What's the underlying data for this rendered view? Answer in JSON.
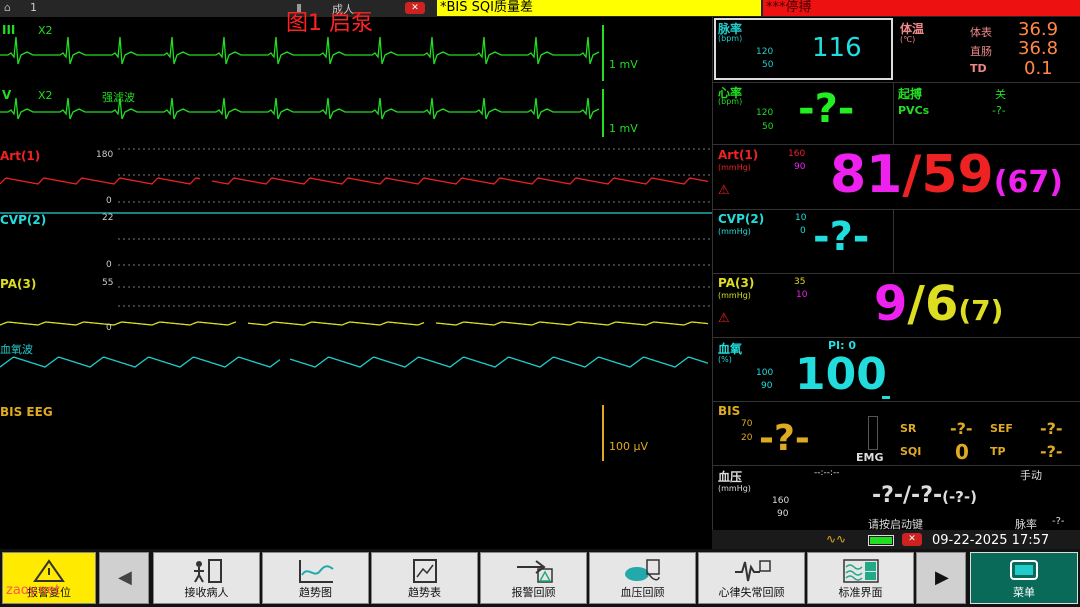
{
  "topbar": {
    "bed_no": "1",
    "patient_type": "成人",
    "overlay_title": "图1 启泵"
  },
  "alarms": {
    "yellow": "*BIS SQI质量差",
    "red": "***停搏"
  },
  "waves": {
    "ecg1": {
      "label": "III",
      "gain": "X2",
      "scale": "1 mV"
    },
    "ecg2": {
      "label": "V",
      "gain": "X2",
      "filter": "强滤波",
      "scale": "1 mV"
    },
    "art": {
      "label": "Art(1)",
      "top": "180",
      "bottom": "0"
    },
    "cvp": {
      "label": "CVP(2)",
      "top": "22",
      "bottom": "0"
    },
    "pa": {
      "label": "PA(3)",
      "top": "55",
      "bottom": "0"
    },
    "spo2": {
      "label": "血氧波"
    },
    "eeg": {
      "label": "BIS EEG",
      "scale": "100 μV"
    }
  },
  "params": {
    "pulse": {
      "label": "脉率",
      "unit": "(bpm)",
      "hi": "120",
      "lo": "50",
      "value": "116"
    },
    "temp": {
      "label": "体温",
      "unit": "(℃)",
      "rows": [
        {
          "name": "体表",
          "value": "36.9"
        },
        {
          "name": "直肠",
          "value": "36.8"
        },
        {
          "name": "TD",
          "value": "0.1"
        }
      ]
    },
    "hr": {
      "label": "心率",
      "unit": "(bpm)",
      "hi": "120",
      "lo": "50",
      "value": "-?-"
    },
    "pace": {
      "label": "起搏",
      "pace_value": "关",
      "pvcs_label": "PVCs",
      "pvcs_value": "-?-"
    },
    "art": {
      "label": "Art(1)",
      "unit": "(mmHg)",
      "hi": "160",
      "lo": "90",
      "sys": "81",
      "sep": "/",
      "dia": "59",
      "mean": "(67)"
    },
    "cvp": {
      "label": "CVP(2)",
      "unit": "(mmHg)",
      "hi": "10",
      "lo": "0",
      "value": "-?-"
    },
    "pa": {
      "label": "PA(3)",
      "unit": "(mmHg)",
      "hi": "35",
      "lo": "10",
      "sys": "9",
      "sep": "/",
      "dia": "6",
      "mean": "(7)"
    },
    "spo2": {
      "label": "血氧",
      "unit": "(%)",
      "pi": "PI: 0",
      "hi": "100",
      "lo": "90",
      "value": "100"
    },
    "bis": {
      "label": "BIS",
      "hi": "70",
      "lo": "20",
      "value": "-?-",
      "emg": "EMG",
      "sr_l": "SR",
      "sr_v": "-?-",
      "sef_l": "SEF",
      "sef_v": "-?-",
      "sqi_l": "SQI",
      "sqi_v": "0",
      "tp_l": "TP",
      "tp_v": "-?-"
    },
    "nibp": {
      "label": "血压",
      "unit": "(mmHg)",
      "time": "--:--:--",
      "mode": "手动",
      "hi": "160",
      "lo": "90",
      "value": "-?-/-?-",
      "mean": "(-?-)",
      "hint": "请按启动键",
      "pr_l": "脉率",
      "pr_v": "-?-"
    }
  },
  "status": {
    "datetime": "09-22-2025 17:57"
  },
  "buttons": [
    {
      "label": "报警复位",
      "icon": "alarm-reset-icon"
    },
    {
      "label": "",
      "icon": "arrow-left-icon"
    },
    {
      "label": "接收病人",
      "icon": "admit-patient-icon"
    },
    {
      "label": "趋势图",
      "icon": "trend-graph-icon"
    },
    {
      "label": "趋势表",
      "icon": "trend-table-icon"
    },
    {
      "label": "报警回顾",
      "icon": "alarm-review-icon"
    },
    {
      "label": "血压回顾",
      "icon": "nibp-review-icon"
    },
    {
      "label": "心律失常回顾",
      "icon": "arrhythmia-review-icon"
    },
    {
      "label": "标准界面",
      "icon": "standard-screen-icon"
    },
    {
      "label": "",
      "icon": "arrow-right-icon"
    },
    {
      "label": "菜单",
      "icon": "menu-icon"
    }
  ],
  "watermark": "zaoy.net",
  "colors": {
    "ecg": "#22dd22",
    "art": "#ee2222",
    "cvp": "#22dddd",
    "pa": "#dddd22",
    "spo2": "#22cccc",
    "eeg": "#ddaa22",
    "sys_magenta": "#ee22ee"
  }
}
